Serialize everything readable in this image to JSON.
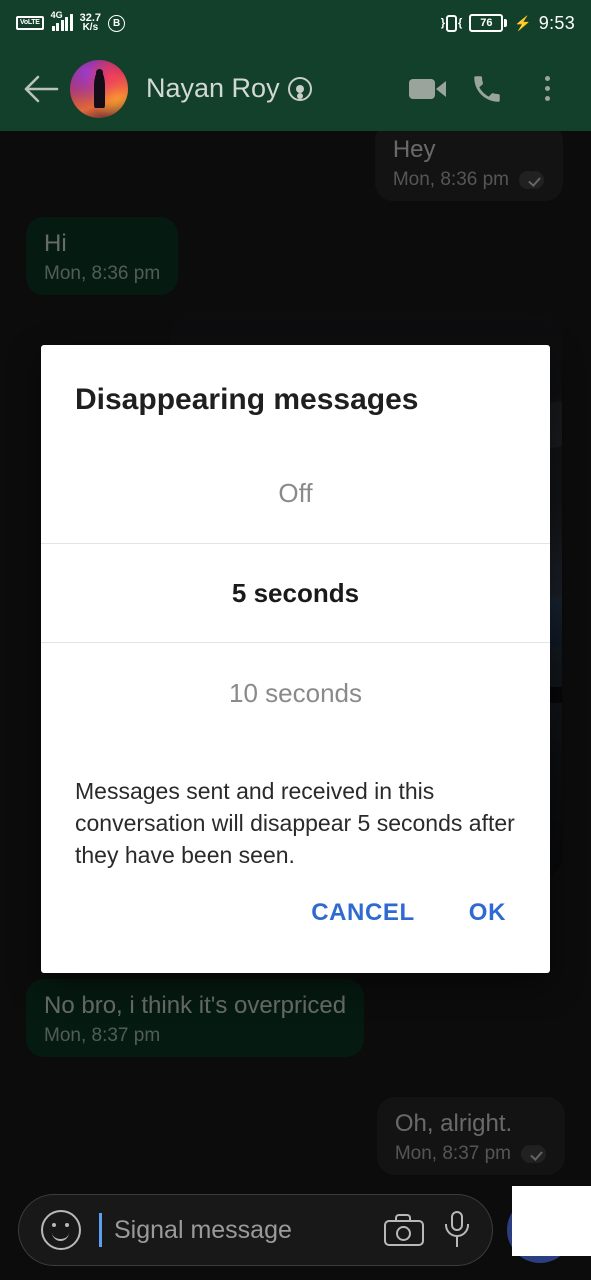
{
  "status_bar": {
    "volte_label": "VoLTE",
    "network_label": "4G",
    "data_speed_value": "32.7",
    "data_speed_unit": "K/s",
    "app_badge_letter": "B",
    "vibrate_icon": "vibrate-icon",
    "battery_level": "76",
    "charging_icon": "charging-bolt-icon",
    "clock": "9:53"
  },
  "app_bar": {
    "back_icon": "back-arrow-icon",
    "avatar": "contact-avatar",
    "contact_name": "Nayan Roy",
    "name_emoji": "person-in-circle-emoji",
    "video_call_icon": "video-call-icon",
    "voice_call_icon": "phone-call-icon",
    "overflow_icon": "more-vertical-icon"
  },
  "chat": {
    "messages": [
      {
        "id": "hey",
        "text": "Hey",
        "time": "Mon, 8:36 pm",
        "direction": "incoming",
        "status": "delivered"
      },
      {
        "id": "hi",
        "text": "Hi",
        "time": "Mon, 8:36 pm",
        "direction": "outgoing",
        "status": ""
      },
      {
        "id": "photo",
        "text": "",
        "time": "",
        "direction": "outgoing",
        "status": ""
      },
      {
        "id": "nobro",
        "text": "No bro, i think it's overpriced",
        "time": "Mon, 8:37 pm",
        "direction": "outgoing",
        "status": ""
      },
      {
        "id": "oh",
        "text": "Oh, alright.",
        "time": "Mon, 8:37 pm",
        "direction": "incoming",
        "status": "delivered"
      }
    ]
  },
  "composer": {
    "emoji_icon": "emoji-icon",
    "placeholder": "Signal message",
    "value": "",
    "camera_icon": "camera-icon",
    "mic_icon": "microphone-icon",
    "send_icon": "send-button"
  },
  "dialog": {
    "title": "Disappearing messages",
    "options": [
      {
        "label": "Off",
        "selected": false
      },
      {
        "label": "5 seconds",
        "selected": true
      },
      {
        "label": "10 seconds",
        "selected": false
      }
    ],
    "description": "Messages sent and received in this conversation will disappear 5 seconds after they have been seen.",
    "cancel_label": "CANCEL",
    "ok_label": "OK",
    "accent_color": "#2e6ad1"
  },
  "colors": {
    "header_green": "#13402b",
    "outgoing_bubble": "#0d3b27",
    "incoming_bubble": "#2a2a2a",
    "send_blue": "#2c3e80",
    "scrim": "rgba(0,0,0,0.55)"
  }
}
